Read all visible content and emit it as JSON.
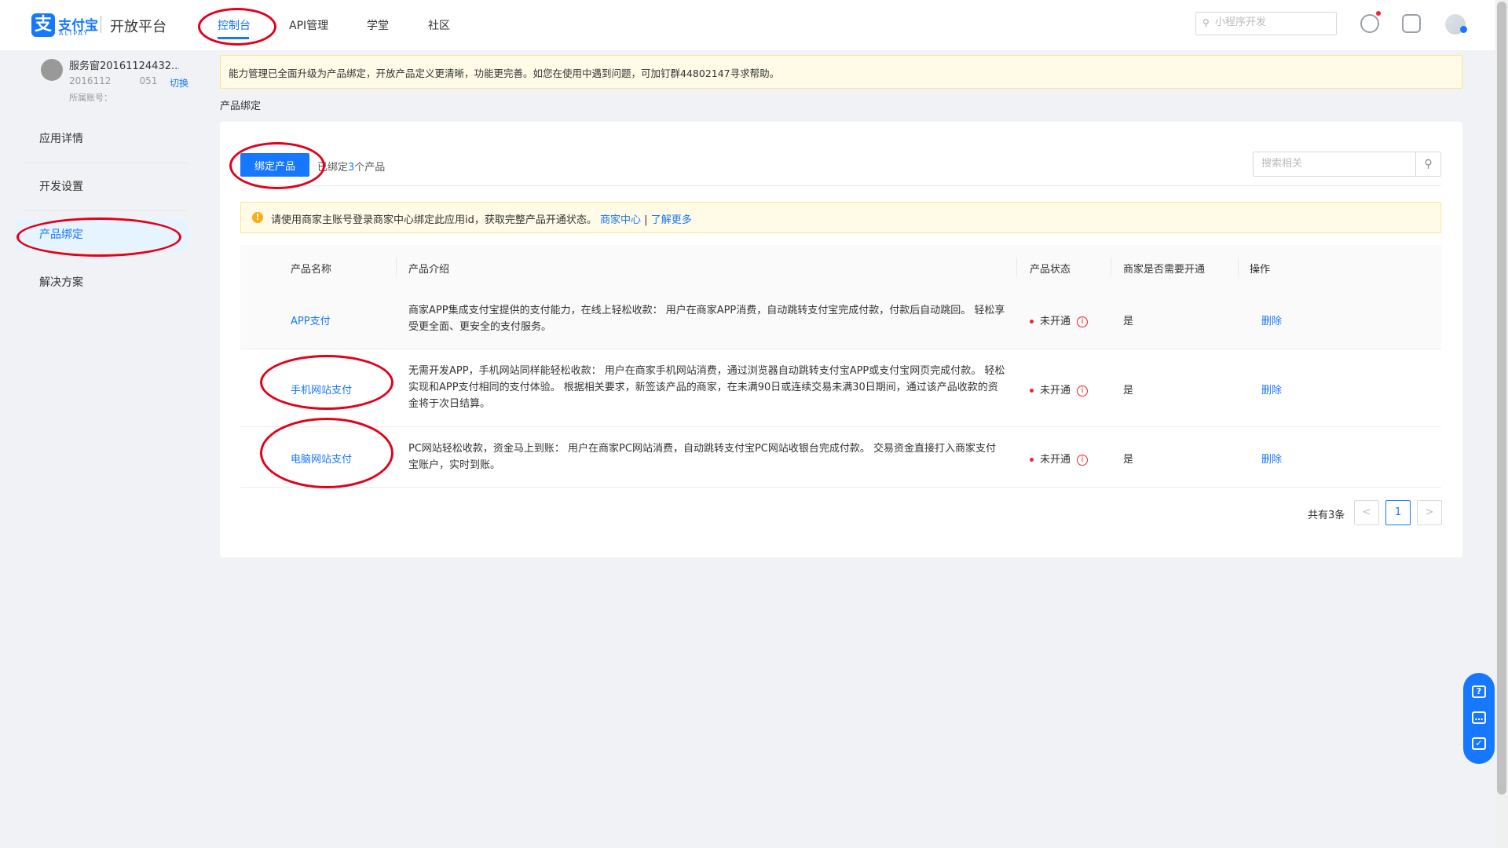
{
  "header": {
    "logo_text": "支付宝",
    "logo_sub": "ALIPAY",
    "platform_title": "开放平台",
    "nav": [
      {
        "label": "控制台",
        "active": true
      },
      {
        "label": "API管理",
        "active": false
      },
      {
        "label": "学堂",
        "active": false
      },
      {
        "label": "社区",
        "active": false
      }
    ],
    "search_placeholder": "小程序开发",
    "icons": [
      "bell-icon",
      "document-icon",
      "user-avatar"
    ]
  },
  "sidebar": {
    "app_name": "服务窗20161124432...",
    "app_id": "2016112   051",
    "switch_label": "切换",
    "account_label": "所属账号：",
    "menu": [
      {
        "label": "应用详情",
        "active": false
      },
      {
        "label": "开发设置",
        "active": false
      },
      {
        "label": "产品绑定",
        "active": true
      },
      {
        "label": "解决方案",
        "active": false
      }
    ]
  },
  "notice": "能力管理已全面升级为产品绑定，开放产品定义更清晰，功能更完善。如您在使用中遇到问题，可加钉群44802147寻求帮助。",
  "breadcrumb": "产品绑定",
  "toolbar": {
    "bind_button": "绑定产品",
    "bound_prefix": "已绑定",
    "bound_count": "3",
    "bound_suffix": "个产品",
    "search_placeholder": "搜索相关"
  },
  "warning": {
    "text": "请使用商家主账号登录商家中心绑定此应用id，获取完整产品开通状态。",
    "link1": "商家中心",
    "separator": " | ",
    "link2": "了解更多"
  },
  "table": {
    "headers": [
      "产品名称",
      "产品介绍",
      "产品状态",
      "商家是否需要开通",
      "操作"
    ],
    "rows": [
      {
        "name": "APP支付",
        "desc": "商家APP集成支付宝提供的支付能力，在线上轻松收款： 用户在商家APP消费，自动跳转支付宝完成付款，付款后自动跳回。 轻松享受更全面、更安全的支付服务。",
        "status": "未开通",
        "need": "是",
        "op": "删除"
      },
      {
        "name": "手机网站支付",
        "desc": "无需开发APP，手机网站同样能轻松收款： 用户在商家手机网站消费，通过浏览器自动跳转支付宝APP或支付宝网页完成付款。 轻松实现和APP支付相同的支付体验。 根据相关要求，新签该产品的商家，在未满90日或连续交易未满30日期间，通过该产品收款的资金将于次日结算。",
        "status": "未开通",
        "need": "是",
        "op": "删除"
      },
      {
        "name": "电脑网站支付",
        "desc": "PC网站轻松收款，资金马上到账： 用户在商家PC网站消费，自动跳转支付宝PC网站收银台完成付款。 交易资金直接打入商家支付宝账户，实时到账。",
        "status": "未开通",
        "need": "是",
        "op": "删除"
      }
    ]
  },
  "pagination": {
    "total": "共有3条",
    "prev": "<",
    "current": "1",
    "next": ">"
  },
  "colors": {
    "primary": "#1677ff",
    "annotation": "#e3001b",
    "status_red": "#f5222d",
    "warning_bg": "#fffbe6"
  }
}
